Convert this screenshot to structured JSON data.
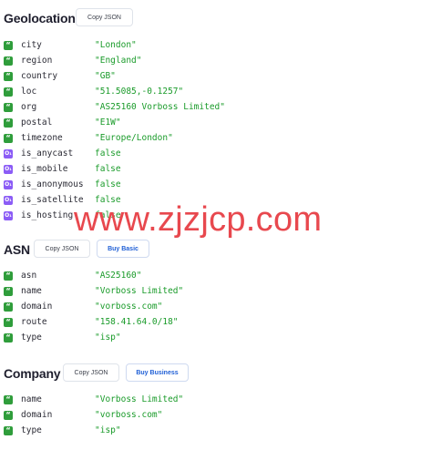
{
  "geolocation": {
    "title": "Geolocation",
    "copy_label": "Copy JSON",
    "fields": [
      {
        "key": "city",
        "value": "\"London\"",
        "icon": "quote-icon"
      },
      {
        "key": "region",
        "value": "\"England\"",
        "icon": "quote-icon"
      },
      {
        "key": "country",
        "value": "\"GB\"",
        "icon": "quote-icon"
      },
      {
        "key": "loc",
        "value": "\"51.5085,-0.1257\"",
        "icon": "quote-icon"
      },
      {
        "key": "org",
        "value": "\"AS25160 Vorboss Limited\"",
        "icon": "quote-icon"
      },
      {
        "key": "postal",
        "value": "\"E1W\"",
        "icon": "quote-icon"
      },
      {
        "key": "timezone",
        "value": "\"Europe/London\"",
        "icon": "quote-icon"
      },
      {
        "key": "is_anycast",
        "value": "false",
        "icon": "boolean-icon"
      },
      {
        "key": "is_mobile",
        "value": "false",
        "icon": "boolean-icon"
      },
      {
        "key": "is_anonymous",
        "value": "false",
        "icon": "boolean-icon"
      },
      {
        "key": "is_satellite",
        "value": "false",
        "icon": "boolean-icon"
      },
      {
        "key": "is_hosting",
        "value": "false",
        "icon": "boolean-icon"
      }
    ]
  },
  "asn": {
    "title": "ASN",
    "copy_label": "Copy JSON",
    "buy_label": "Buy Basic",
    "fields": [
      {
        "key": "asn",
        "value": "\"AS25160\"",
        "icon": "quote-icon"
      },
      {
        "key": "name",
        "value": "\"Vorboss Limited\"",
        "icon": "quote-icon"
      },
      {
        "key": "domain",
        "value": "\"vorboss.com\"",
        "icon": "quote-icon"
      },
      {
        "key": "route",
        "value": "\"158.41.64.0/18\"",
        "icon": "quote-icon"
      },
      {
        "key": "type",
        "value": "\"isp\"",
        "icon": "quote-icon"
      }
    ]
  },
  "company": {
    "title": "Company",
    "copy_label": "Copy JSON",
    "buy_label": "Buy Business",
    "fields": [
      {
        "key": "name",
        "value": "\"Vorboss Limited\"",
        "icon": "quote-icon"
      },
      {
        "key": "domain",
        "value": "\"vorboss.com\"",
        "icon": "quote-icon"
      },
      {
        "key": "type",
        "value": "\"isp\"",
        "icon": "quote-icon"
      }
    ]
  },
  "watermark": "www.zjzjcp.com",
  "colors": {
    "string_value": "#1a9b2a",
    "quote_icon_bg": "#2f9d3b",
    "boolean_icon_bg": "#8b5cf6",
    "watermark": "#e8484e",
    "buy_button_text": "#1f5fd6"
  }
}
